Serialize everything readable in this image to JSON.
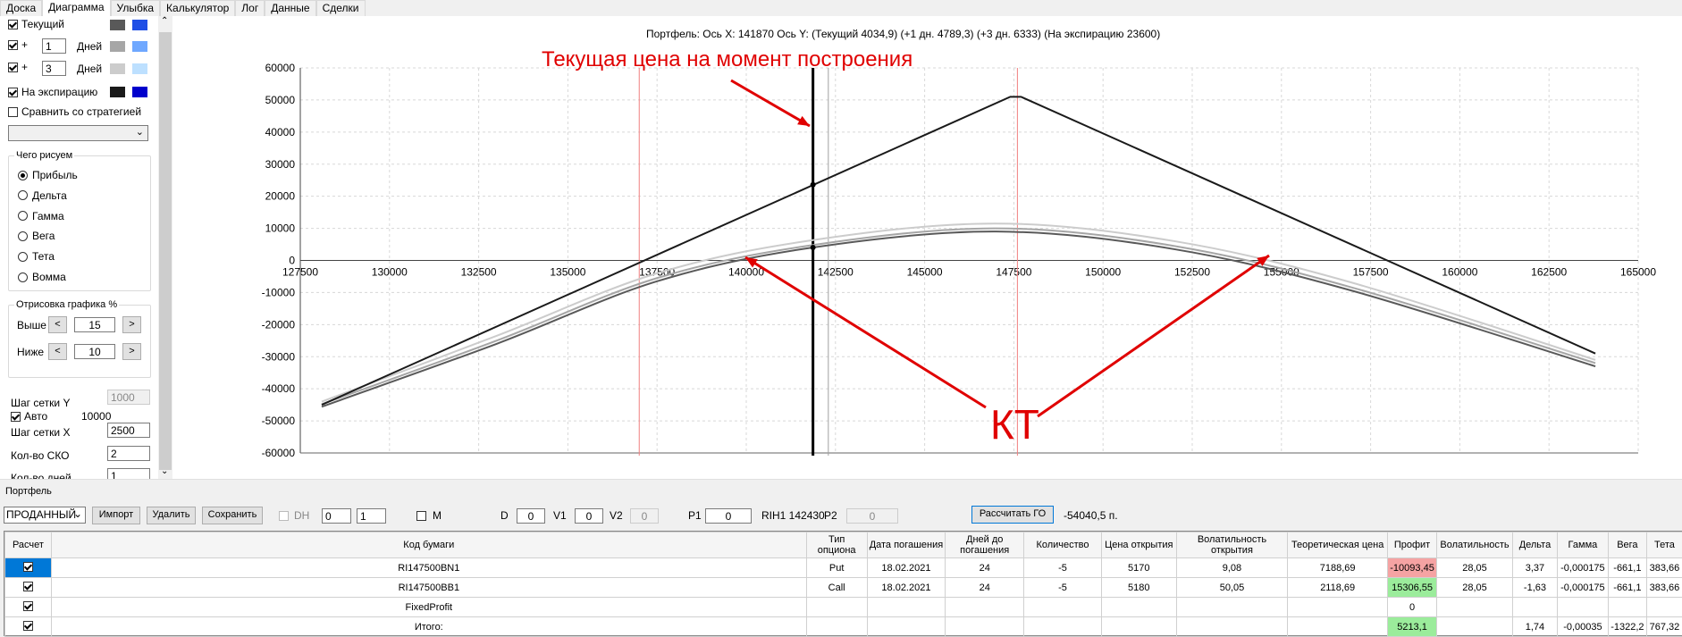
{
  "tabs": [
    "Доска",
    "Диаграмма",
    "Улыбка",
    "Калькулятор",
    "Лог",
    "Данные",
    "Сделки"
  ],
  "sidebar": {
    "current_label": "Текущий",
    "plus1": {
      "sign": "+",
      "value": "1",
      "unit": "Дней"
    },
    "plus3": {
      "sign": "+",
      "value": "3",
      "unit": "Дней"
    },
    "expiration_label": "На экспирацию",
    "compare_label": "Сравнить со стратегией",
    "draw_group_title": "Чего рисуем",
    "radios": [
      "Прибыль",
      "Дельта",
      "Гамма",
      "Вега",
      "Тета",
      "Вомма"
    ],
    "render_group_title": "Отрисовка графика %",
    "above_label": "Выше",
    "above_value": "15",
    "below_label": "Ниже",
    "below_value": "10",
    "grid_y_label": "Шаг сетки Y",
    "grid_y_value": "1000",
    "auto_label": "Авто",
    "auto_value": "10000",
    "grid_x_label": "Шаг сетки X",
    "grid_x_value": "2500",
    "sko_label": "Кол-во СКО",
    "sko_value": "2",
    "days_label": "Кол-во дней",
    "days_value": "1",
    "colors": {
      "current": [
        "#595959",
        "#1f4fe6"
      ],
      "plus1": [
        "#a6a6a6",
        "#6fa8ff"
      ],
      "plus3": [
        "#cccccc",
        "#bde0ff"
      ],
      "expiration": [
        "#1a1a1a",
        "#0000cc"
      ]
    }
  },
  "chart_header": "Портфель: Ось X:  141870 Ось Y:  (Текущий 4034,9)  (+1 дн. 4789,3)  (+3 дн. 6333)  (На экспирацию 23600)",
  "annotation_price": "Текущая цена на момент построения",
  "annotation_kt": "КТ",
  "chart_data": {
    "type": "line",
    "xlim": [
      127500,
      165000
    ],
    "ylim": [
      -60000,
      60000
    ],
    "x_ticks": [
      127500,
      130000,
      132500,
      135000,
      137500,
      140000,
      142500,
      145000,
      147500,
      150000,
      152500,
      155000,
      157500,
      160000,
      162500,
      165000
    ],
    "y_ticks": [
      60000,
      50000,
      40000,
      30000,
      20000,
      10000,
      0,
      -10000,
      -20000,
      -30000,
      -40000,
      -50000,
      -60000
    ],
    "x_tick_labels": [
      "127500",
      "130000",
      "132500",
      "135000",
      "137500",
      "140000",
      "142500",
      "145000",
      "147500",
      "150000",
      "152500",
      "155000",
      "157500",
      "160000",
      "162500",
      "165000"
    ],
    "y_tick_labels": [
      "60000",
      "50000",
      "40000",
      "30000",
      "20000",
      "10000",
      "0",
      "-10000",
      "-20000",
      "-30000",
      "-40000",
      "-50000",
      "-60000"
    ],
    "series": [
      {
        "color": "#1a1a1a",
        "x": [
          128100,
          147400,
          147700,
          163800
        ],
        "y": [
          -45000,
          51000,
          51000,
          -29000
        ]
      },
      {
        "color": "#595959",
        "x": [
          128100,
          133000,
          137500,
          141870,
          147000,
          152000,
          157000,
          163800
        ],
        "y": [
          -45600,
          -26000,
          -6500,
          4035,
          9000,
          3500,
          -9500,
          -33000
        ]
      },
      {
        "color": "#a6a6a6",
        "x": [
          128100,
          133000,
          137500,
          141870,
          147000,
          152000,
          157000,
          163800
        ],
        "y": [
          -44800,
          -25000,
          -5500,
          4790,
          10000,
          4500,
          -8500,
          -32000
        ]
      },
      {
        "color": "#cccccc",
        "x": [
          128100,
          133000,
          137500,
          141870,
          147000,
          152000,
          157000,
          163800
        ],
        "y": [
          -44000,
          -23500,
          -4000,
          6333,
          11500,
          6000,
          -7000,
          -31000
        ]
      }
    ],
    "vlines": [
      {
        "x": 137000,
        "color": "#f08080"
      },
      {
        "x": 141870,
        "color": "#000000"
      },
      {
        "x": 142300,
        "color": "#a0a0a0"
      },
      {
        "x": 147600,
        "color": "#f08080"
      }
    ],
    "markers": [
      {
        "x": 141870,
        "y": 23600
      },
      {
        "x": 141870,
        "y": 4035
      }
    ],
    "grid": true
  },
  "portfolio": {
    "label": "Портфель",
    "dropdown": "ПРОДАННЫЙ",
    "import_label": "Импорт",
    "delete_label": "Удалить",
    "save_label": "Сохранить",
    "dh_label": "DH",
    "dh_v1": "0",
    "dh_v2": "1",
    "m_label": "M",
    "d_label": "D",
    "d_value": "0",
    "v1_label": "V1",
    "v1_value": "0",
    "v2_label": "V2",
    "v2_value": "0",
    "p1_label": "P1",
    "p1_value": "0",
    "rih_label": "RIH1 142430",
    "p2_label": "P2",
    "p2_value": "0",
    "calc_label": "Рассчитать ГО",
    "go_value": "-54040,5 п."
  },
  "table": {
    "headers": [
      "Расчет",
      "Код бумаги",
      "Тип опциона",
      "Дата погашения",
      "Дней до погашения",
      "Количество",
      "Цена открытия",
      "Волатильность открытия",
      "Теоретическая цена",
      "Профит",
      "Волатильность",
      "Дельта",
      "Гамма",
      "Вега",
      "Тета"
    ],
    "rows": [
      [
        "RI147500BN1",
        "Put",
        "18.02.2021",
        "24",
        "-5",
        "5170",
        "9,08",
        "7188,69",
        "-10093,45",
        "28,05",
        "3,37",
        "-0,000175",
        "-661,1",
        "383,66"
      ],
      [
        "RI147500BB1",
        "Call",
        "18.02.2021",
        "24",
        "-5",
        "5180",
        "50,05",
        "2118,69",
        "15306,55",
        "28,05",
        "-1,63",
        "-0,000175",
        "-661,1",
        "383,66"
      ],
      [
        "FixedProfit",
        "",
        "",
        "",
        "",
        "",
        "",
        "",
        "0",
        "",
        "",
        "",
        "",
        ""
      ],
      [
        "Итого:",
        "",
        "",
        "",
        "",
        "",
        "",
        "",
        "5213,1",
        "",
        "1,74",
        "-0,00035",
        "-1322,2",
        "767,32"
      ]
    ]
  }
}
